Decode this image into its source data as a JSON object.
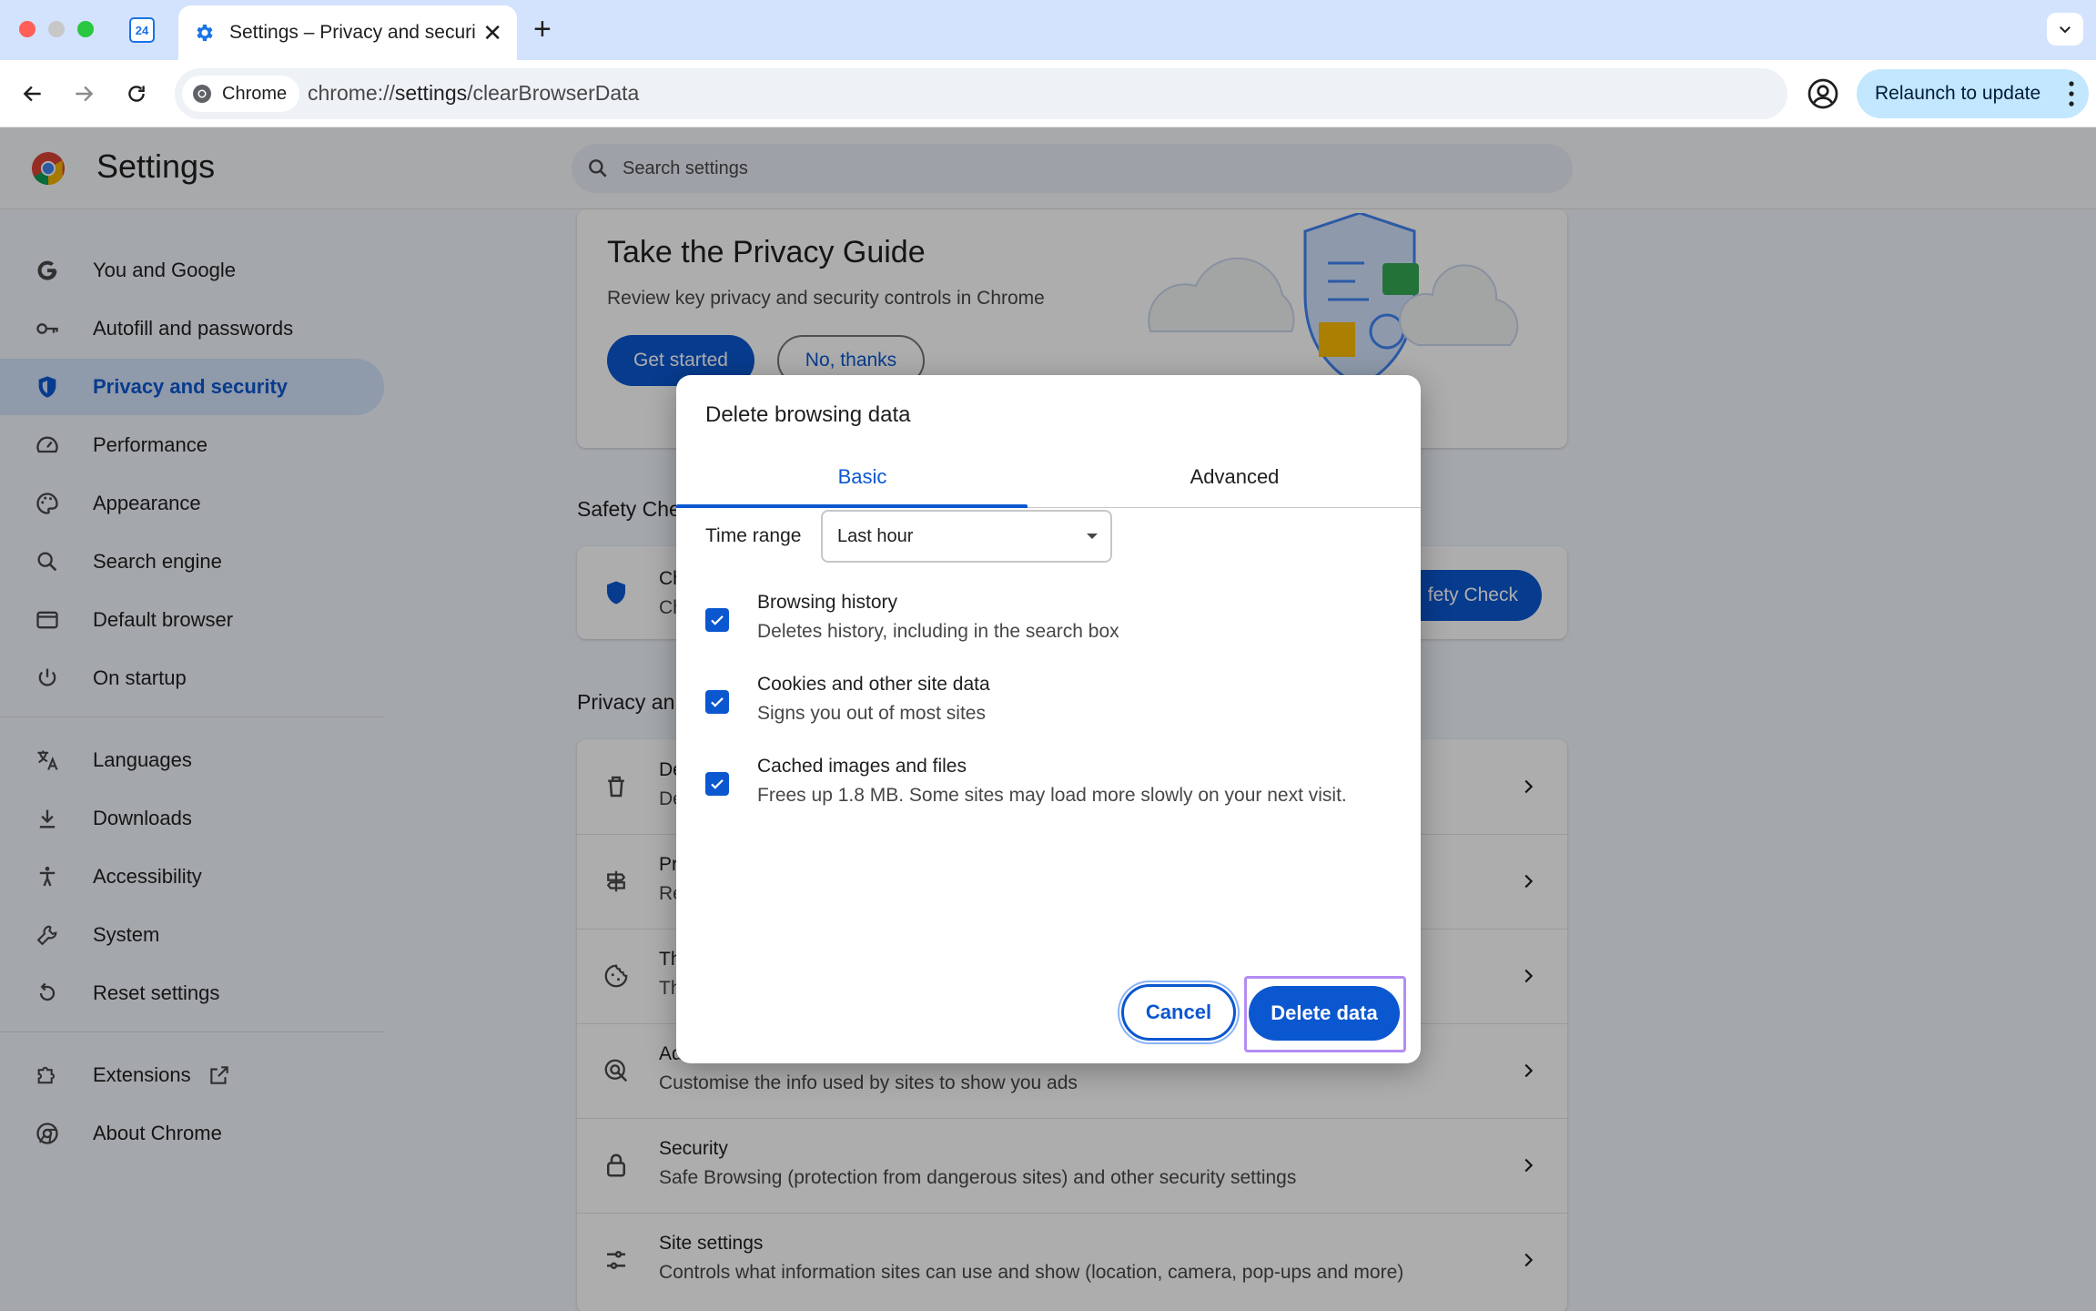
{
  "browser": {
    "pinned_tab_label": "24",
    "active_tab_title": "Settings – Privacy and securit",
    "new_tab_symbol": "+",
    "close_symbol": "✕",
    "chip_label": "Chrome",
    "url_prefix": "chrome://",
    "url_host": "settings",
    "url_path": "/clearBrowserData",
    "relaunch_label": "Relaunch to update"
  },
  "settings": {
    "title": "Settings",
    "search_placeholder": "Search settings",
    "sidebar": [
      {
        "label": "You and Google",
        "icon": "google-g-icon"
      },
      {
        "label": "Autofill and passwords",
        "icon": "key-icon"
      },
      {
        "label": "Privacy and security",
        "icon": "shield-icon",
        "active": true
      },
      {
        "label": "Performance",
        "icon": "speedometer-icon"
      },
      {
        "label": "Appearance",
        "icon": "palette-icon"
      },
      {
        "label": "Search engine",
        "icon": "search-icon"
      },
      {
        "label": "Default browser",
        "icon": "browser-window-icon"
      },
      {
        "label": "On startup",
        "icon": "power-icon"
      },
      {
        "label": "Languages",
        "icon": "translate-icon"
      },
      {
        "label": "Downloads",
        "icon": "download-icon"
      },
      {
        "label": "Accessibility",
        "icon": "accessibility-icon"
      },
      {
        "label": "System",
        "icon": "wrench-icon"
      },
      {
        "label": "Reset settings",
        "icon": "reset-icon"
      },
      {
        "label": "Extensions",
        "icon": "puzzle-icon"
      },
      {
        "label": "About Chrome",
        "icon": "chrome-icon"
      }
    ],
    "privacy_guide": {
      "title": "Take the Privacy Guide",
      "description": "Review key privacy and security controls in Chrome",
      "get_started": "Get started",
      "no_thanks": "No, thanks"
    },
    "safety_check": {
      "section_label": "Safety Che",
      "row_title": "Ch",
      "row_sub": "Ch",
      "button": "fety Check"
    },
    "privacy_section": {
      "section_label": "Privacy an",
      "rows": [
        {
          "title": "De",
          "sub": "De",
          "icon": "trash-icon"
        },
        {
          "title": "Pr",
          "sub": "Re",
          "icon": "signpost-icon"
        },
        {
          "title": "Th",
          "sub": "Th",
          "icon": "cookie-icon"
        },
        {
          "title": "Ad",
          "sub": "Customise the info used by sites to show you ads",
          "icon": "ads-icon"
        },
        {
          "title": "Security",
          "sub": "Safe Browsing (protection from dangerous sites) and other security settings",
          "icon": "lock-icon"
        },
        {
          "title": "Site settings",
          "sub": "Controls what information sites can use and show (location, camera, pop-ups and more)",
          "icon": "sliders-icon"
        }
      ]
    }
  },
  "dialog": {
    "title": "Delete browsing data",
    "tabs": {
      "basic": "Basic",
      "advanced": "Advanced"
    },
    "time_range_label": "Time range",
    "time_range_value": "Last hour",
    "options": [
      {
        "title": "Browsing history",
        "sub": "Deletes history, including in the search box",
        "checked": true
      },
      {
        "title": "Cookies and other site data",
        "sub": "Signs you out of most sites",
        "checked": true
      },
      {
        "title": "Cached images and files",
        "sub": "Frees up 1.8 MB. Some sites may load more slowly on your next visit.",
        "checked": true
      }
    ],
    "cancel": "Cancel",
    "delete": "Delete data"
  }
}
